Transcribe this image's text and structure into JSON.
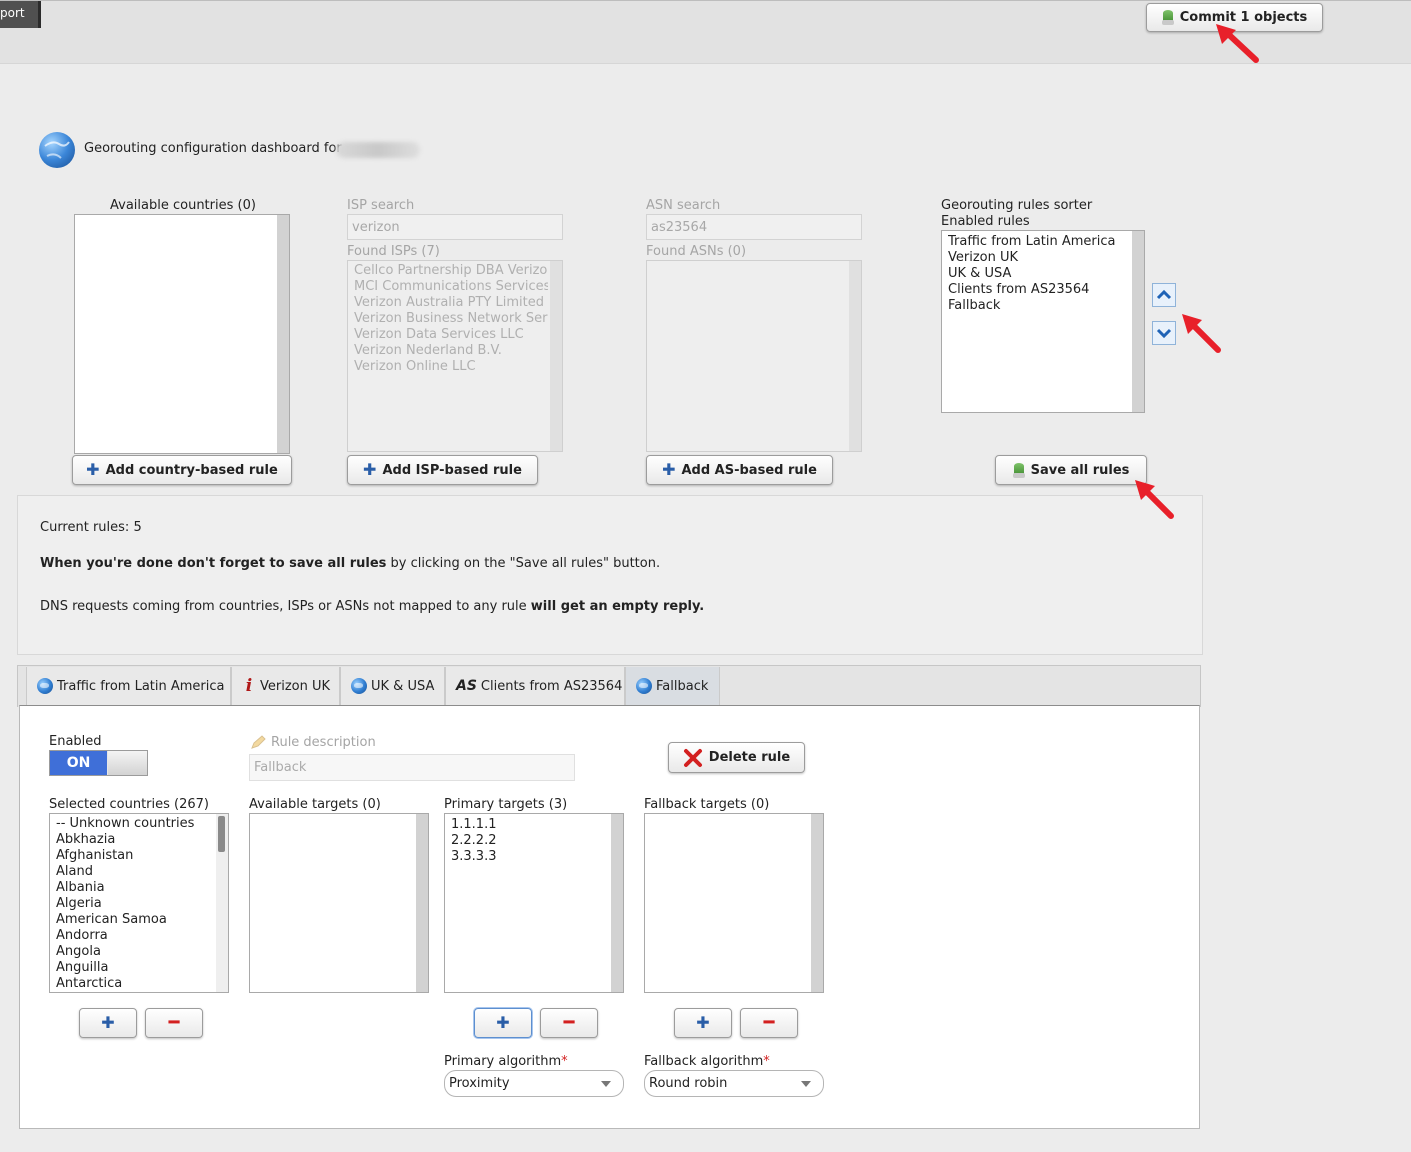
{
  "topbar": {
    "left_tab": "port",
    "commit_button": "Commit 1 objects"
  },
  "dashboard": {
    "title": "Georouting configuration dashboard for"
  },
  "countries": {
    "label": "Available countries (0)",
    "add_button": "Add country-based rule"
  },
  "isp": {
    "search_label": "ISP search",
    "search_value": "verizon",
    "found_label": "Found ISPs (7)",
    "items": [
      "Cellco Partnership DBA Verizon",
      "MCI Communications Services,",
      "Verizon Australia PTY Limited",
      "Verizon Business Network Serv",
      "Verizon Data Services LLC",
      "Verizon Nederland B.V.",
      "Verizon Online LLC"
    ],
    "add_button": "Add ISP-based rule"
  },
  "asn": {
    "search_label": "ASN search",
    "search_value": "as23564",
    "found_label": "Found ASNs (0)",
    "add_button": "Add AS-based rule"
  },
  "sorter": {
    "title": "Georouting rules sorter",
    "subtitle": "Enabled rules",
    "items": [
      "Traffic from Latin America",
      "Verizon UK",
      "UK & USA",
      "Clients from AS23564",
      "Fallback"
    ],
    "save_button": "Save all rules"
  },
  "info": {
    "current_rules": "Current rules: 5",
    "reminder_bold": "When you're done don't forget to save all rules",
    "reminder_rest": " by clicking on the \"Save all rules\" button.",
    "dns_text": "DNS requests coming from countries, ISPs or ASNs not mapped to any rule ",
    "dns_bold": "will get an empty reply."
  },
  "tabs": [
    {
      "label": "Traffic from Latin America",
      "icon": "globe-icon"
    },
    {
      "label": "Verizon UK",
      "icon": "isp-info-icon"
    },
    {
      "label": "UK & USA",
      "icon": "globe-icon"
    },
    {
      "label": "Clients from AS23564",
      "icon": "as-icon",
      "icon_text": "AS"
    },
    {
      "label": "Fallback",
      "icon": "globe-icon"
    }
  ],
  "rule": {
    "enabled_label": "Enabled",
    "toggle_state": "ON",
    "description_label": "Rule description",
    "description_value": "Fallback",
    "delete_button": "Delete rule",
    "selected_countries_label": "Selected countries (267)",
    "selected_countries": [
      "-- Unknown countries",
      "Abkhazia",
      "Afghanistan",
      "Aland",
      "Albania",
      "Algeria",
      "American Samoa",
      "Andorra",
      "Angola",
      "Anguilla",
      "Antarctica"
    ],
    "available_targets_label": "Available targets (0)",
    "primary_targets_label": "Primary targets (3)",
    "primary_targets": [
      "1.1.1.1",
      "2.2.2.2",
      "3.3.3.3"
    ],
    "fallback_targets_label": "Fallback targets (0)",
    "primary_algorithm_label": "Primary algorithm",
    "primary_algorithm_value": "Proximity",
    "fallback_algorithm_label": "Fallback algorithm",
    "fallback_algorithm_value": "Round robin",
    "required_mark": "*"
  },
  "colors": {
    "accent_blue": "#3f6fd8",
    "annotation_red": "#e8202a",
    "delete_red": "#d32020"
  }
}
